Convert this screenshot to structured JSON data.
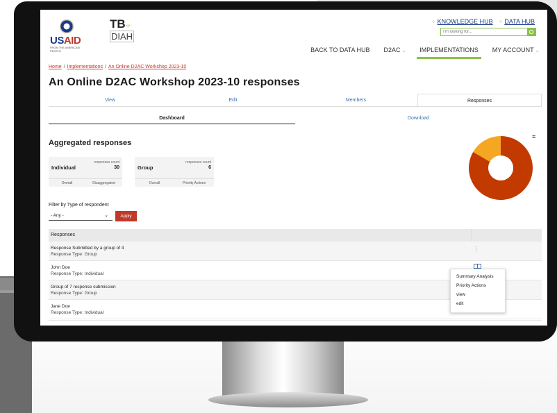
{
  "header": {
    "logo_usaid": {
      "us": "US",
      "aid": "AID",
      "sub": "FROM THE AMERICAN PEOPLE"
    },
    "logo_tb": {
      "tb": "TB",
      "diah": "DIAH"
    },
    "knowledge_hub": "KNOWLEDGE HUB",
    "data_hub": "DATA HUB",
    "search_placeholder": "I'm looking for...",
    "nav": {
      "back": "BACK TO DATA HUB",
      "d2ac": "D2AC",
      "implementations": "IMPLEMENTATIONS",
      "account": "MY ACCOUNT"
    },
    "accent_color": "#8bc34a"
  },
  "breadcrumb": {
    "home": "Home",
    "implementations": "Implementations",
    "current": "An Online D2AC Workshop 2023-10"
  },
  "page_title": "An Online D2AC Workshop 2023-10 responses",
  "tabs": {
    "view": "View",
    "edit": "Edit",
    "members": "Members",
    "responses": "Responses"
  },
  "subtabs": {
    "dashboard": "Dashboard",
    "download": "Download"
  },
  "aggregated": {
    "title": "Aggregated responses",
    "cards": [
      {
        "name": "Individual",
        "label": "responses count",
        "count": "30",
        "left": "Overall",
        "right": "Disaggregated"
      },
      {
        "name": "Group",
        "label": "responses count",
        "count": "6",
        "left": "Overall",
        "right": "Priority Actions"
      }
    ]
  },
  "chart_data": {
    "type": "pie",
    "categories": [
      "Individual",
      "Group"
    ],
    "values": [
      30,
      6
    ],
    "colors": [
      "#c23a00",
      "#f5a623"
    ],
    "donut": true
  },
  "filter": {
    "label": "Filter by Type of respondent",
    "selected": "- Any -",
    "apply": "Apply",
    "apply_color": "#c0392b"
  },
  "table": {
    "header": "Responses",
    "rows": [
      {
        "name": "Response Submitted by a group of 4",
        "type": "Response Type: Group"
      },
      {
        "name": "John Doe",
        "type": "Response Type: Individual"
      },
      {
        "name": "Group of 7 response submission",
        "type": "Response Type: Group"
      },
      {
        "name": "Jane Doe",
        "type": "Response Type: Individual"
      }
    ]
  },
  "row_menu": {
    "items": [
      "Summary Analysis",
      "Priority Actions",
      "view",
      "edit"
    ]
  }
}
